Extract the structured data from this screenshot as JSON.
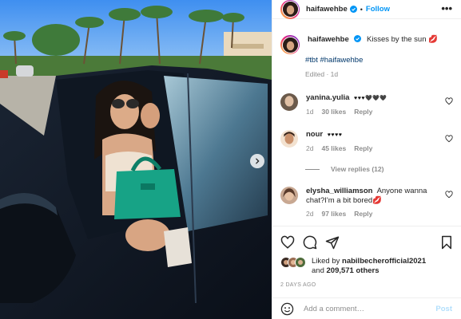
{
  "post": {
    "author": "haifawehbe",
    "follow_label": "Follow",
    "more_label": "•••",
    "caption": "Kisses by the sun 💋",
    "tags": "#tbt #haifawehbe",
    "edited": "Edited · 1d",
    "likes_prefix": "Liked by",
    "liked_by_user": "nabilbecherofficial2021",
    "likes_and": "and",
    "likes_count": "209,571 others",
    "date": "2 DAYS AGO"
  },
  "comments": [
    {
      "user": "yanina.yulia",
      "text": "♥♥♥🖤🖤🖤",
      "age": "1d",
      "likes": "30 likes",
      "reply": "Reply"
    },
    {
      "user": "nour",
      "text": "♥♥♥♥",
      "age": "2d",
      "likes": "45 likes",
      "reply": "Reply",
      "view_replies": "View replies (12)"
    },
    {
      "user": "elysha_williamson",
      "text": "Anyone wanna chat?I'm a bit bored💋",
      "age": "2d",
      "likes": "97 likes",
      "reply": "Reply"
    }
  ],
  "composer": {
    "placeholder": "Add a comment…",
    "post_label": "Post"
  },
  "icons": {
    "verified": "verified-badge-icon",
    "like": "heart-icon",
    "comment": "comment-icon",
    "share": "share-icon",
    "save": "bookmark-icon",
    "emoji": "emoji-icon",
    "next": "chevron-right-icon"
  },
  "colors": {
    "accent": "#0095f6",
    "link": "#00376b",
    "muted": "#8e8e8e",
    "post_disabled": "#b2dffc"
  }
}
